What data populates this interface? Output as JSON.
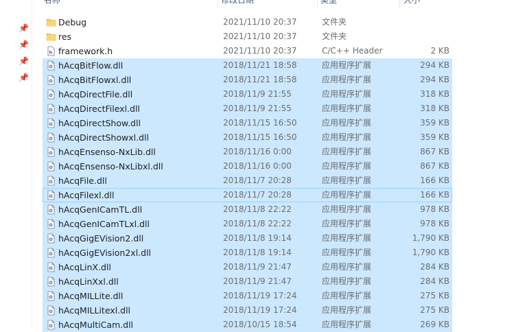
{
  "columns": {
    "name": "名称",
    "date": "修改日期",
    "type": "类型",
    "size": "大小"
  },
  "icons": {
    "folder": "folder-icon",
    "header_file": "header-file-icon",
    "dll": "dll-file-icon",
    "pin": "pin-icon"
  },
  "colors": {
    "selection": "#cce8ff",
    "focus_border": "#99d1ff",
    "folder": "#f3c55a"
  },
  "files": [
    {
      "name": "Debug",
      "date": "2021/11/10 20:37",
      "type": "文件夹",
      "size": "",
      "icon": "folder",
      "selected": false
    },
    {
      "name": "res",
      "date": "2021/11/10 20:37",
      "type": "文件夹",
      "size": "",
      "icon": "folder",
      "selected": false
    },
    {
      "name": "framework.h",
      "date": "2021/11/10 20:37",
      "type": "C/C++ Header",
      "size": "2 KB",
      "icon": "header",
      "selected": false
    },
    {
      "name": "hAcqBitFlow.dll",
      "date": "2018/11/21 18:58",
      "type": "应用程序扩展",
      "size": "294 KB",
      "icon": "dll",
      "selected": true
    },
    {
      "name": "hAcqBitFlowxl.dll",
      "date": "2018/11/21 18:58",
      "type": "应用程序扩展",
      "size": "294 KB",
      "icon": "dll",
      "selected": true
    },
    {
      "name": "hAcqDirectFile.dll",
      "date": "2018/11/9 21:55",
      "type": "应用程序扩展",
      "size": "318 KB",
      "icon": "dll",
      "selected": true
    },
    {
      "name": "hAcqDirectFilexl.dll",
      "date": "2018/11/9 21:55",
      "type": "应用程序扩展",
      "size": "318 KB",
      "icon": "dll",
      "selected": true
    },
    {
      "name": "hAcqDirectShow.dll",
      "date": "2018/11/15 16:50",
      "type": "应用程序扩展",
      "size": "359 KB",
      "icon": "dll",
      "selected": true
    },
    {
      "name": "hAcqDirectShowxl.dll",
      "date": "2018/11/15 16:50",
      "type": "应用程序扩展",
      "size": "359 KB",
      "icon": "dll",
      "selected": true
    },
    {
      "name": "hAcqEnsenso-NxLib.dll",
      "date": "2018/11/16 0:00",
      "type": "应用程序扩展",
      "size": "867 KB",
      "icon": "dll",
      "selected": true
    },
    {
      "name": "hAcqEnsenso-NxLibxl.dll",
      "date": "2018/11/16 0:00",
      "type": "应用程序扩展",
      "size": "867 KB",
      "icon": "dll",
      "selected": true
    },
    {
      "name": "hAcqFile.dll",
      "date": "2018/11/7 20:28",
      "type": "应用程序扩展",
      "size": "166 KB",
      "icon": "dll",
      "selected": true
    },
    {
      "name": "hAcqFilexl.dll",
      "date": "2018/11/7 20:28",
      "type": "应用程序扩展",
      "size": "166 KB",
      "icon": "dll",
      "selected": true,
      "focused": true
    },
    {
      "name": "hAcqGenICamTL.dll",
      "date": "2018/11/8 22:22",
      "type": "应用程序扩展",
      "size": "978 KB",
      "icon": "dll",
      "selected": true
    },
    {
      "name": "hAcqGenICamTLxl.dll",
      "date": "2018/11/8 22:22",
      "type": "应用程序扩展",
      "size": "978 KB",
      "icon": "dll",
      "selected": true
    },
    {
      "name": "hAcqGigEVision2.dll",
      "date": "2018/11/8 19:14",
      "type": "应用程序扩展",
      "size": "1,790 KB",
      "icon": "dll",
      "selected": true
    },
    {
      "name": "hAcqGigEVision2xl.dll",
      "date": "2018/11/8 19:14",
      "type": "应用程序扩展",
      "size": "1,790 KB",
      "icon": "dll",
      "selected": true
    },
    {
      "name": "hAcqLinX.dll",
      "date": "2018/11/9 21:47",
      "type": "应用程序扩展",
      "size": "284 KB",
      "icon": "dll",
      "selected": true
    },
    {
      "name": "hAcqLinXxl.dll",
      "date": "2018/11/9 21:47",
      "type": "应用程序扩展",
      "size": "284 KB",
      "icon": "dll",
      "selected": true
    },
    {
      "name": "hAcqMILLite.dll",
      "date": "2018/11/19 17:24",
      "type": "应用程序扩展",
      "size": "275 KB",
      "icon": "dll",
      "selected": true
    },
    {
      "name": "hAcqMILLitexl.dll",
      "date": "2018/11/19 17:24",
      "type": "应用程序扩展",
      "size": "275 KB",
      "icon": "dll",
      "selected": true
    },
    {
      "name": "hAcqMultiCam.dll",
      "date": "2018/10/15 18:54",
      "type": "应用程序扩展",
      "size": "269 KB",
      "icon": "dll",
      "selected": true
    }
  ]
}
